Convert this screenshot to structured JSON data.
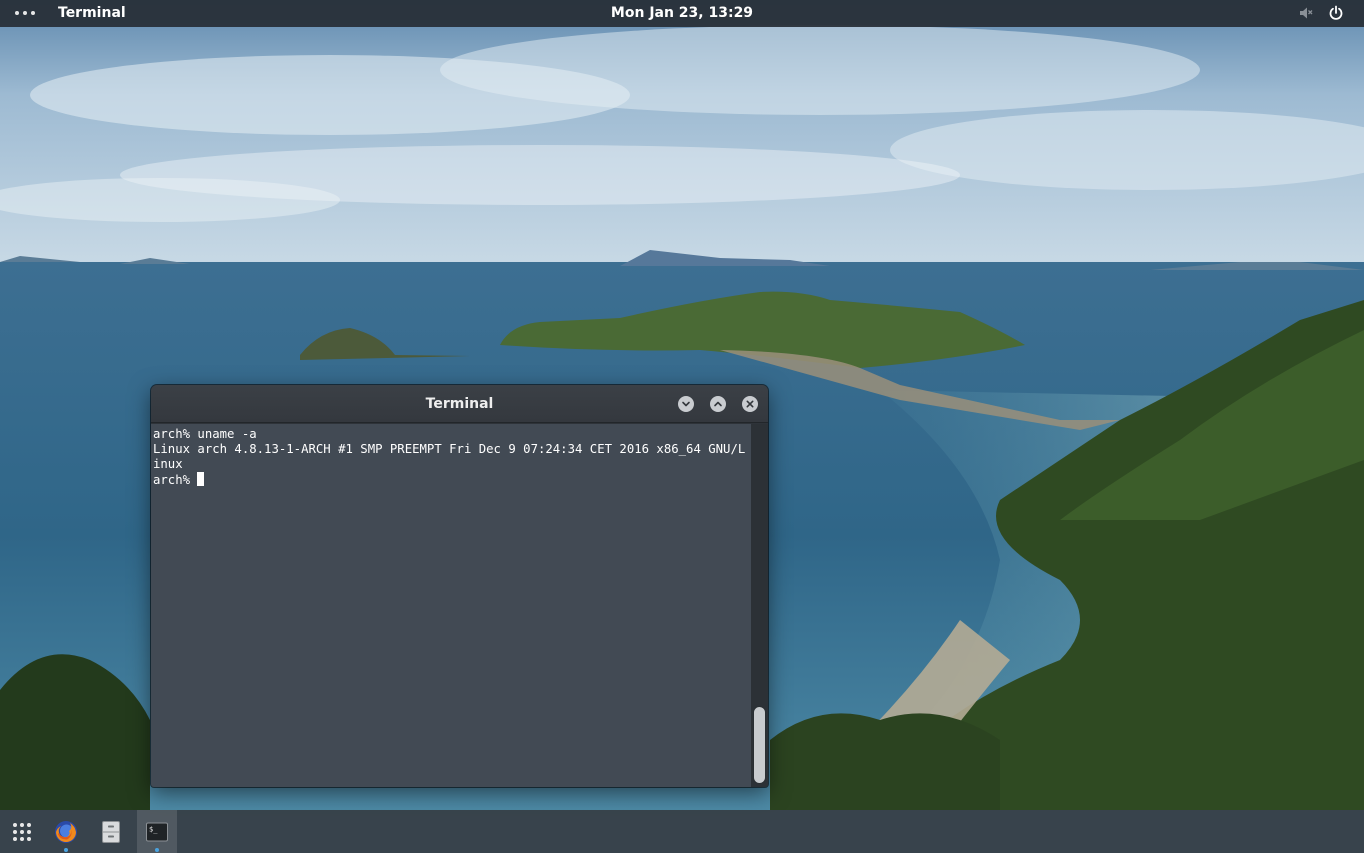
{
  "topbar": {
    "app_name": "Terminal",
    "clock": "Mon Jan 23, 13:29",
    "icons": [
      "menu-dots-icon",
      "volume-muted-icon",
      "power-icon"
    ]
  },
  "terminal": {
    "title": "Terminal",
    "lines": [
      "arch% uname -a",
      "Linux arch 4.8.13-1-ARCH #1 SMP PREEMPT Fri Dec 9 07:24:34 CET 2016 x86_64 GNU/L",
      "inux"
    ],
    "prompt": "arch% ",
    "buttons": [
      "minimize-icon",
      "maximize-icon",
      "close-icon"
    ]
  },
  "dock": {
    "items": [
      {
        "name": "app-grid",
        "icon": "app-grid-icon",
        "running": false
      },
      {
        "name": "firefox",
        "icon": "firefox-icon",
        "running": true
      },
      {
        "name": "files",
        "icon": "file-cabinet-icon",
        "running": false
      },
      {
        "name": "terminal",
        "icon": "terminal-icon",
        "running": true,
        "active": true
      }
    ]
  },
  "colors": {
    "topbar_bg": "#262c34",
    "terminal_bg": "#424a54",
    "titlebar_bg": "#383c42",
    "accent": "#4aa3e0"
  }
}
